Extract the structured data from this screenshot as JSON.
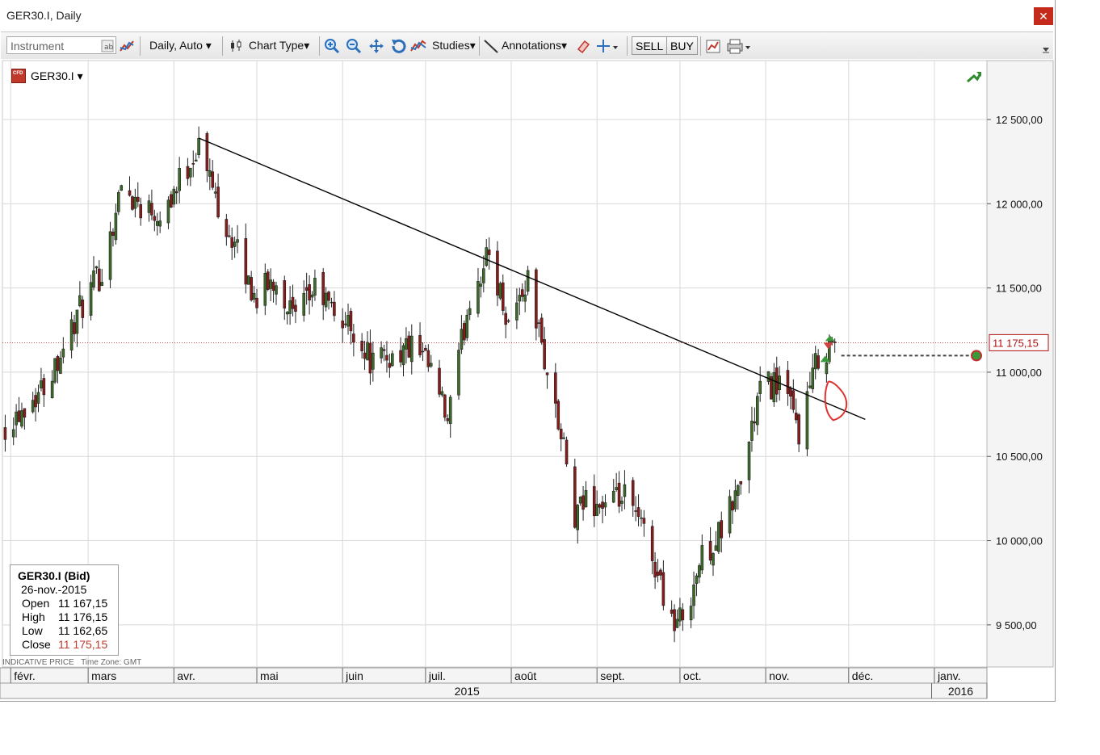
{
  "window": {
    "title": "GER30.I, Daily",
    "close_symbol": "✕"
  },
  "toolbar": {
    "instrument_placeholder": "Instrument",
    "period_label": "Daily, Auto",
    "chart_type_label": "Chart Type",
    "studies_label": "Studies",
    "annotations_label": "Annotations",
    "sell_label": "SELL",
    "buy_label": "BUY",
    "dropdown_symbol": "▾"
  },
  "chart": {
    "instrument_label": "GER30.I",
    "current_price_label": "11 175,15",
    "footnote_price": "INDICATIVE PRICE",
    "footnote_tz": "Time Zone: GMT",
    "colors": {
      "bull": "#3d6b2a",
      "bear": "#8b1b1b",
      "price_line": "#b01010",
      "trendline": "#000000",
      "grid": "#d8d8d8",
      "annotation": "#e03030"
    }
  },
  "ohlc_box": {
    "title": "GER30.I (Bid)",
    "date": "26-nov.-2015",
    "rows": [
      {
        "label": "Open",
        "value": "11 167,15"
      },
      {
        "label": "High",
        "value": "11 176,15"
      },
      {
        "label": "Low",
        "value": "11 162,65"
      },
      {
        "label": "Close",
        "value": "11 175,15"
      }
    ]
  },
  "chart_data": {
    "type": "candlestick",
    "title": "GER30.I, Daily",
    "ylim": [
      9250,
      12850
    ],
    "yticks": [
      {
        "value": 12500,
        "label": "12 500,00"
      },
      {
        "value": 12000,
        "label": "12 000,00"
      },
      {
        "value": 11500,
        "label": "11 500,00"
      },
      {
        "value": 11000,
        "label": "11 000,00"
      },
      {
        "value": 10500,
        "label": "10 500,00"
      },
      {
        "value": 10000,
        "label": "10 000,00"
      },
      {
        "value": 9500,
        "label": "9 500,00"
      }
    ],
    "xlim": [
      "2015-01-29",
      "2016-01-20"
    ],
    "months": [
      {
        "date": "2015-02-01",
        "label": "févr."
      },
      {
        "date": "2015-03-01",
        "label": "mars"
      },
      {
        "date": "2015-04-01",
        "label": "avr."
      },
      {
        "date": "2015-05-01",
        "label": "mai"
      },
      {
        "date": "2015-06-01",
        "label": "juin"
      },
      {
        "date": "2015-07-01",
        "label": "juil."
      },
      {
        "date": "2015-08-01",
        "label": "août"
      },
      {
        "date": "2015-09-01",
        "label": "sept."
      },
      {
        "date": "2015-10-01",
        "label": "oct."
      },
      {
        "date": "2015-11-01",
        "label": "nov."
      },
      {
        "date": "2015-12-01",
        "label": "déc."
      },
      {
        "date": "2016-01-01",
        "label": "janv."
      }
    ],
    "years": [
      {
        "label": "2015",
        "from": "2015-01-29",
        "to": "2015-12-31"
      },
      {
        "label": "2016",
        "from": "2016-01-01",
        "to": "2016-01-20"
      }
    ],
    "current_price": 11175.15,
    "trendline": {
      "from": {
        "date": "2015-04-10",
        "value": 12390
      },
      "to": {
        "date": "2015-12-07",
        "value": 10720
      }
    },
    "closes": [
      {
        "date": "2015-01-30",
        "close": 10690
      },
      {
        "date": "2015-02-13",
        "close": 10920
      },
      {
        "date": "2015-02-27",
        "close": 11400
      },
      {
        "date": "2015-03-06",
        "close": 11600
      },
      {
        "date": "2015-03-13",
        "close": 12100
      },
      {
        "date": "2015-03-20",
        "close": 12000
      },
      {
        "date": "2015-03-27",
        "close": 11950
      },
      {
        "date": "2015-04-02",
        "close": 12100
      },
      {
        "date": "2015-04-10",
        "close": 12350
      },
      {
        "date": "2015-04-17",
        "close": 12000
      },
      {
        "date": "2015-04-24",
        "close": 11700
      },
      {
        "date": "2015-04-30",
        "close": 11450
      },
      {
        "date": "2015-05-08",
        "close": 11550
      },
      {
        "date": "2015-05-15",
        "close": 11300
      },
      {
        "date": "2015-05-22",
        "close": 11500
      },
      {
        "date": "2015-05-29",
        "close": 11350
      },
      {
        "date": "2015-06-05",
        "close": 11250
      },
      {
        "date": "2015-06-12",
        "close": 11050
      },
      {
        "date": "2015-06-19",
        "close": 11100
      },
      {
        "date": "2015-06-26",
        "close": 11150
      },
      {
        "date": "2015-07-03",
        "close": 11000
      },
      {
        "date": "2015-07-09",
        "close": 10700
      },
      {
        "date": "2015-07-17",
        "close": 11450
      },
      {
        "date": "2015-07-24",
        "close": 11700
      },
      {
        "date": "2015-07-31",
        "close": 11300
      },
      {
        "date": "2015-08-07",
        "close": 11550
      },
      {
        "date": "2015-08-14",
        "close": 11000
      },
      {
        "date": "2015-08-21",
        "close": 10450
      },
      {
        "date": "2015-08-24",
        "close": 10100
      },
      {
        "date": "2015-08-28",
        "close": 10250
      },
      {
        "date": "2015-09-04",
        "close": 10200
      },
      {
        "date": "2015-09-11",
        "close": 10250
      },
      {
        "date": "2015-09-18",
        "close": 10050
      },
      {
        "date": "2015-09-25",
        "close": 9700
      },
      {
        "date": "2015-09-29",
        "close": 9500
      },
      {
        "date": "2015-10-02",
        "close": 9550
      },
      {
        "date": "2015-10-09",
        "close": 9900
      },
      {
        "date": "2015-10-16",
        "close": 10050
      },
      {
        "date": "2015-10-23",
        "close": 10350
      },
      {
        "date": "2015-10-30",
        "close": 10900
      },
      {
        "date": "2015-11-06",
        "close": 10950
      },
      {
        "date": "2015-11-13",
        "close": 10650
      },
      {
        "date": "2015-11-20",
        "close": 11100
      },
      {
        "date": "2015-11-26",
        "close": 11175
      }
    ]
  }
}
